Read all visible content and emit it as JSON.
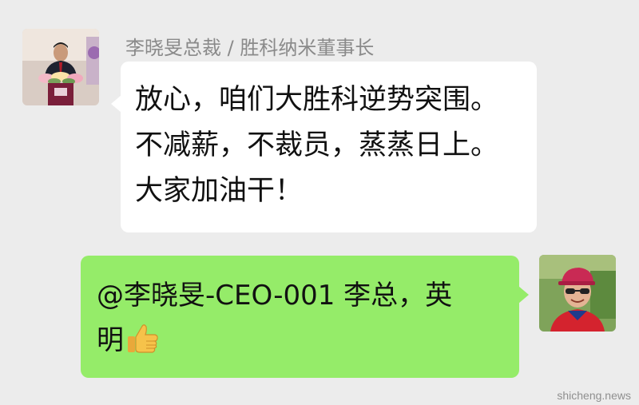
{
  "incoming": {
    "sender_name": "李晓旻总裁 / 胜科纳米董事长",
    "avatar_icon": "avatar-man-at-podium",
    "lines": [
      "放心，咱们大胜科逆势突围。",
      "不减薪，不裁员，蒸蒸日上。",
      "大家加油干！"
    ],
    "bubble_color": "#ffffff"
  },
  "outgoing": {
    "avatar_icon": "avatar-man-red-cap-sunglasses",
    "lines": [
      "@李晓旻-CEO-001 李总，英",
      "明"
    ],
    "emoji": "thumbs-up-emoji",
    "bubble_color": "#95ec69"
  },
  "watermark": "shicheng.news",
  "background_color": "#ececec"
}
